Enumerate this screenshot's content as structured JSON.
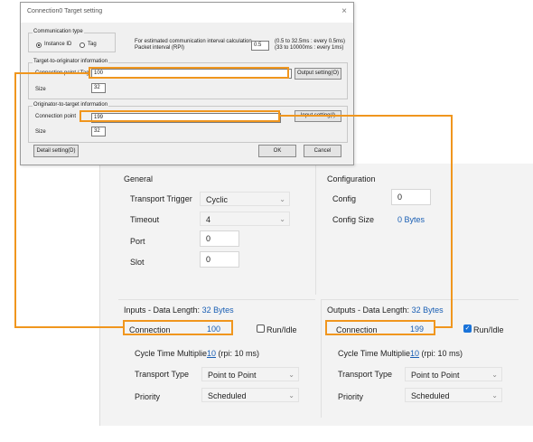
{
  "dialog": {
    "title": "Connection0 Target setting",
    "close": "×",
    "comm_type": {
      "label": "Communication type",
      "instance_id": "Instance ID",
      "tag": "Tag",
      "selected": "Instance ID"
    },
    "rpi": {
      "label_line1": "For estimated communication interval calculation",
      "label_line2": "Packet interval (RPI)",
      "value": "0.5",
      "range_line1": "(0.5 to 32.5ms : every 0.5ms)",
      "range_line2": "(33 to 10000ms : every 1ms)"
    },
    "t2o": {
      "label": "Target-to-originator information",
      "conn_label": "Connection point / Tag",
      "conn_value": "100",
      "size_label": "Size",
      "size_value": "32",
      "button": "Output setting(O)"
    },
    "o2t": {
      "label": "Originator-to-target information",
      "conn_label": "Connection point",
      "conn_value": "199",
      "size_label": "Size",
      "size_value": "32",
      "button": "Input setting(I)"
    },
    "detail_button": "Detail setting(D)",
    "ok": "OK",
    "cancel": "Cancel"
  },
  "general": {
    "title": "General",
    "transport_trigger_label": "Transport Trigger",
    "transport_trigger_value": "Cyclic",
    "timeout_label": "Timeout",
    "timeout_value": "4",
    "port_label": "Port",
    "port_value": "0",
    "slot_label": "Slot",
    "slot_value": "0"
  },
  "configuration": {
    "title": "Configuration",
    "config_label": "Config",
    "config_value": "0",
    "config_size_label": "Config Size",
    "config_size_value": "0 Bytes"
  },
  "inputs": {
    "title": "Inputs - Data Length: ",
    "length": "32 Bytes",
    "connection_label": "Connection",
    "connection_value": "100",
    "run_idle_label": "Run/Idle",
    "run_idle_checked": false,
    "cycle_time_label": "Cycle Time Multiplie",
    "cycle_time_value": "10",
    "cycle_time_rpi": " (rpi: 10 ms)",
    "transport_type_label": "Transport Type",
    "transport_type_value": "Point to Point",
    "priority_label": "Priority",
    "priority_value": "Scheduled"
  },
  "outputs": {
    "title": "Outputs - Data Length: ",
    "length": "32 Bytes",
    "connection_label": "Connection",
    "connection_value": "199",
    "run_idle_label": "Run/Idle",
    "run_idle_checked": true,
    "cycle_time_label": "Cycle Time Multiplie",
    "cycle_time_value": "10",
    "cycle_time_rpi": " (rpi: 10 ms)",
    "transport_type_label": "Transport Type",
    "transport_type_value": "Point to Point",
    "priority_label": "Priority",
    "priority_value": "Scheduled"
  },
  "colors": {
    "accent_link": "#1a5fb4",
    "annotation_orange": "#f0961e",
    "checkbox_blue": "#1a73d9"
  }
}
